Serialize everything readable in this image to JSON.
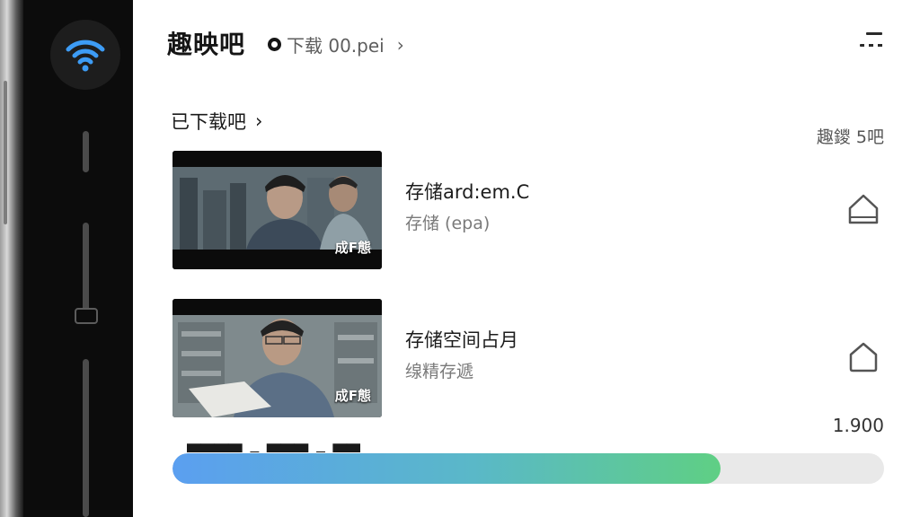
{
  "header": {
    "app_title": "趣映吧",
    "breadcrumb": "下载 00.pei"
  },
  "section": {
    "label": "已下载吧",
    "count_text": "趣鑁 5吧"
  },
  "items": [
    {
      "title": "存储ard:em.C",
      "subtitle": "存储 (epa)",
      "thumb_caption": "成F態"
    },
    {
      "title": "存储空间占月",
      "subtitle": "缐精存遞",
      "thumb_caption": "成F態"
    }
  ],
  "storage": {
    "value_text": "1.900",
    "fill_percent": 77,
    "partial_label": "████ ▪ ███ ▪ ██"
  },
  "colors": {
    "bar_start": "#5b9ff0",
    "bar_end": "#5fcf84",
    "wifi": "#3d9cf5"
  },
  "icons": {
    "wifi": "wifi-icon",
    "menu": "menu-icon",
    "breadcrumb_dot": "record-dot-icon",
    "item_1_action": "home-icon",
    "item_2_action": "pentagon-icon"
  }
}
